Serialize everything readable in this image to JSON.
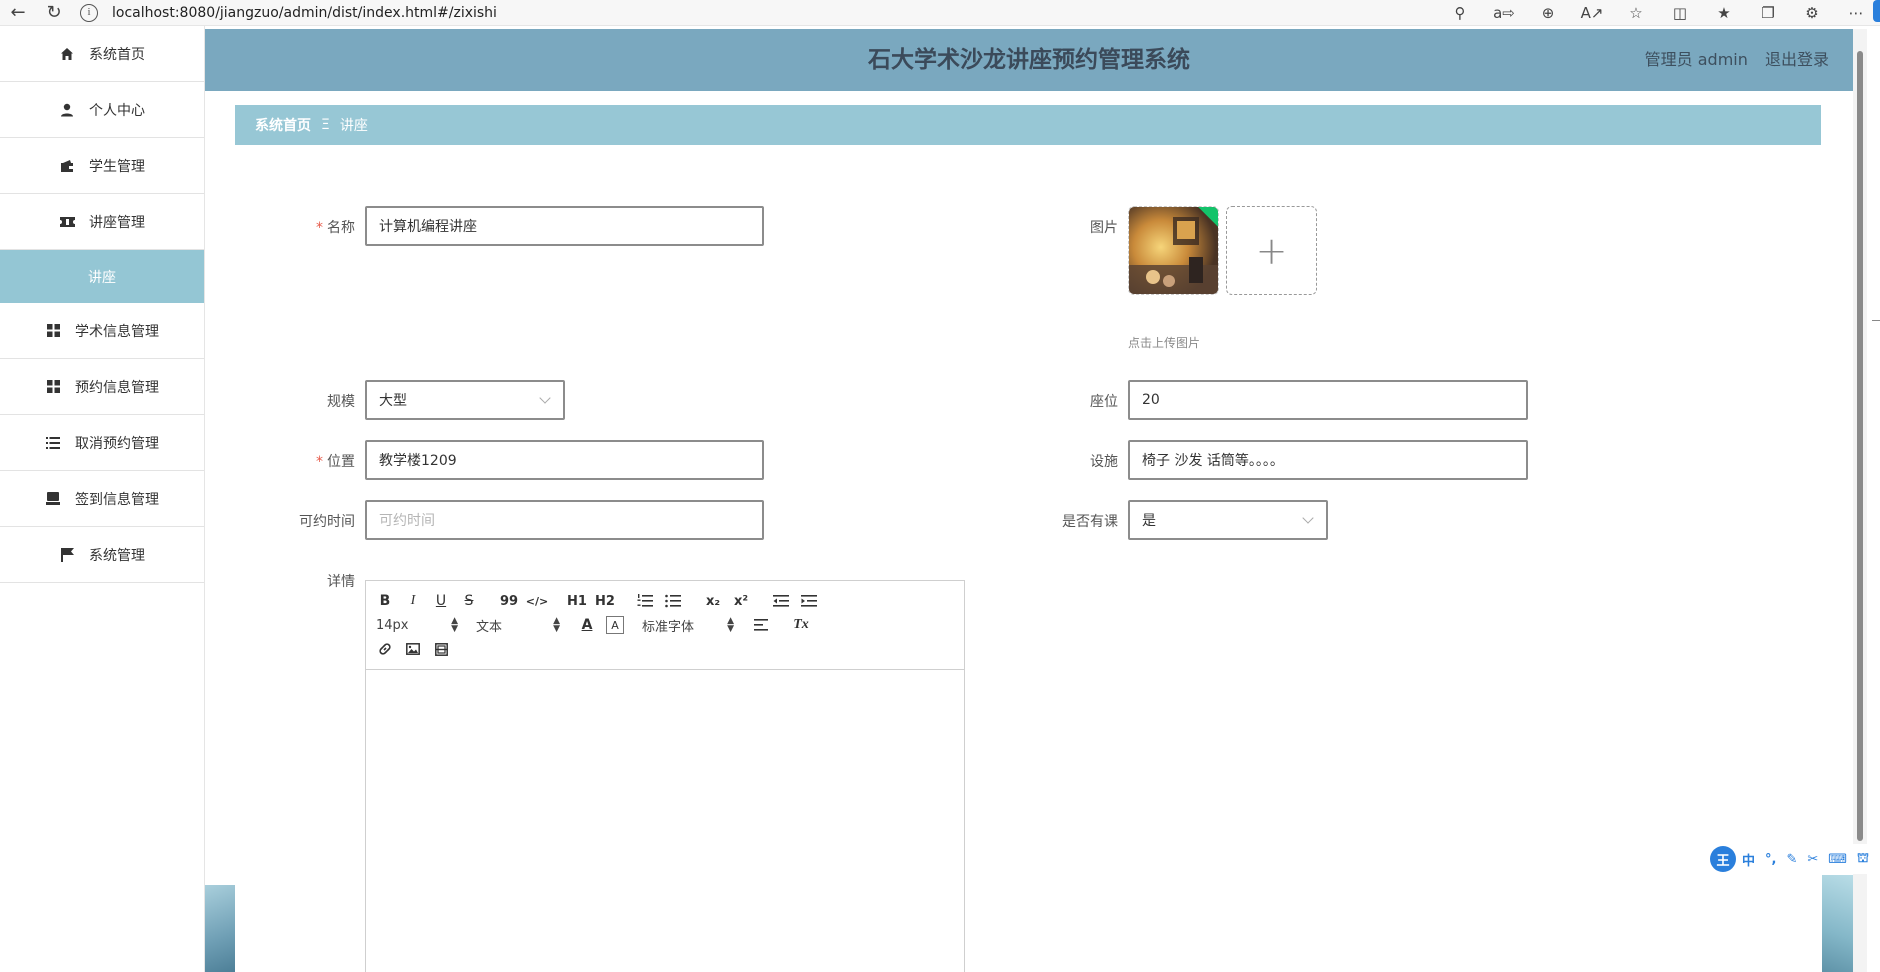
{
  "browser": {
    "url": "localhost:8080/jiangzuo/admin/dist/index.html#/zixishi",
    "info_icon": "i"
  },
  "sidebar": {
    "items": [
      {
        "label": "系统首页",
        "icon": "home-icon"
      },
      {
        "label": "个人中心",
        "icon": "user-icon"
      },
      {
        "label": "学生管理",
        "icon": "wallet-icon"
      },
      {
        "label": "讲座管理",
        "icon": "ticket-icon"
      },
      {
        "label": "学术信息管理",
        "icon": "grid-icon"
      },
      {
        "label": "预约信息管理",
        "icon": "grid-icon"
      },
      {
        "label": "取消预约管理",
        "icon": "list-icon"
      },
      {
        "label": "签到信息管理",
        "icon": "inbox-icon"
      },
      {
        "label": "系统管理",
        "icon": "flag-icon"
      }
    ],
    "active_sub": "讲座"
  },
  "header": {
    "title": "石大学术沙龙讲座预约管理系统",
    "user_label": "管理员 admin",
    "logout": "退出登录"
  },
  "breadcrumb": {
    "home": "系统首页",
    "sep": "Ξ",
    "current": "讲座"
  },
  "form": {
    "name": {
      "label": "名称",
      "value": "计算机编程讲座"
    },
    "image": {
      "label": "图片",
      "tip": "点击上传图片",
      "add": "+"
    },
    "scale": {
      "label": "规模",
      "value": "大型"
    },
    "seats": {
      "label": "座位",
      "value": "20"
    },
    "location": {
      "label": "位置",
      "value": "教学楼1209"
    },
    "facilities": {
      "label": "设施",
      "value": "椅子 沙发 话筒等。。。。"
    },
    "time": {
      "label": "可约时间",
      "placeholder": "可约时间"
    },
    "has_class": {
      "label": "是否有课",
      "value": "是"
    },
    "details": {
      "label": "详情"
    }
  },
  "editor": {
    "font_size": "14px",
    "header_select": "文本",
    "font_family": "标准字体",
    "buttons": {
      "bold": "B",
      "italic": "I",
      "underline": "U",
      "strike": "S",
      "quote": "99",
      "code": "</>",
      "h1": "H1",
      "h2": "H2",
      "sub": "x₂",
      "sup": "x²",
      "clean": "Tx"
    }
  },
  "ime": {
    "logo": "王",
    "lang": "中",
    "punct": "°,"
  },
  "colors": {
    "header_bg": "#7aa8bf",
    "breadcrumb_bg": "#97c7d5",
    "active_menu_bg": "#94c6d4",
    "required": "#e65a4a"
  }
}
